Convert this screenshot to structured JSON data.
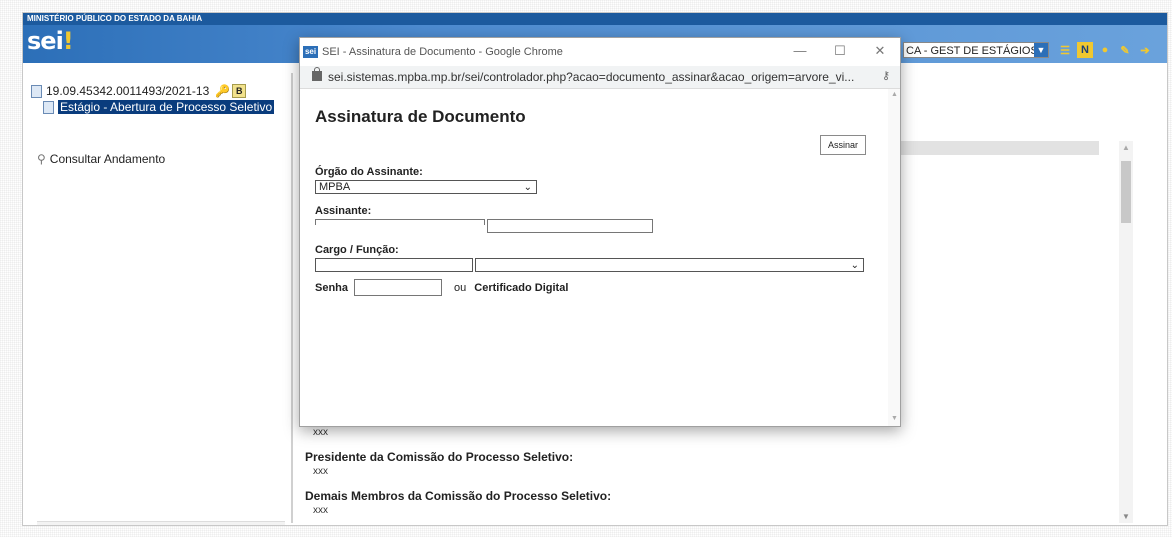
{
  "header": {
    "org_name": "MINISTÉRIO PÚBLICO DO ESTADO DA BAHIA",
    "logo_text": "sei",
    "logo_dot": "!",
    "unit_selector": "CA - GEST DE ESTÁGIOS"
  },
  "tree": {
    "process_number": "19.09.45342.0011493/2021-13",
    "badge": "B",
    "document_label": "Estágio - Abertura de Processo Seletivo",
    "consult_link": "Consultar Andamento"
  },
  "content": {
    "xxx1": "xxx",
    "president_label": "Presidente da Comissão do Processo Seletivo:",
    "xxx2": "xxx",
    "members_label": "Demais Membros da Comissão do Processo Seletivo:",
    "xxx3": "xxx"
  },
  "popup": {
    "window_logo": "sei",
    "window_title": "SEI - Assinatura de Documento - Google Chrome",
    "url": "sei.sistemas.mpba.mp.br/sei/controlador.php?acao=documento_assinar&acao_origem=arvore_vi...",
    "heading": "Assinatura de Documento",
    "sign_button": "Assinar",
    "orgao_label": "Órgão do Assinante:",
    "orgao_value": "MPBA",
    "assinante_label": "Assinante:",
    "cargo_label": "Cargo / Função:",
    "senha_label": "Senha",
    "ou_label": "ou",
    "cert_label": "Certificado Digital"
  },
  "colors": {
    "banner": "#2c6fb8",
    "selection": "#0a3c7d"
  }
}
